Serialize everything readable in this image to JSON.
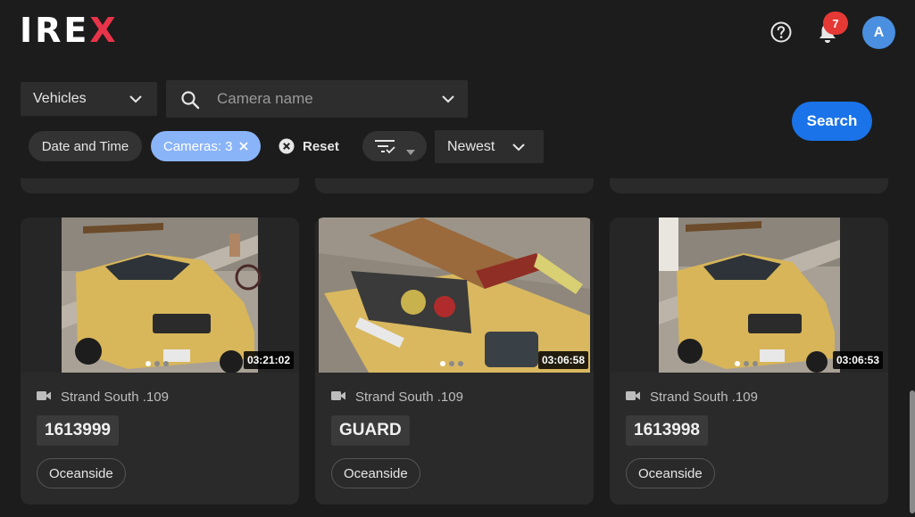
{
  "header": {
    "logo_main": "IRE",
    "logo_x": "X",
    "notification_count": "7",
    "avatar_initial": "A",
    "icons": [
      "help-circle-icon",
      "bell-icon"
    ]
  },
  "filters": {
    "type_value": "Vehicles",
    "camera_placeholder": "Camera name",
    "date_chip": "Date and Time",
    "cameras_chip": "Cameras: 3",
    "reset_label": "Reset",
    "sort_value": "Newest",
    "search_label": "Search"
  },
  "results": [
    {
      "timestamp": "03:21:02",
      "camera": "Strand South .109",
      "plate": "1613999",
      "location": "Oceanside",
      "dot_active": 0
    },
    {
      "timestamp": "03:06:58",
      "camera": "Strand South .109",
      "plate": "GUARD",
      "location": "Oceanside",
      "dot_active": 0
    },
    {
      "timestamp": "03:06:53",
      "camera": "Strand South .109",
      "plate": "1613998",
      "location": "Oceanside",
      "dot_active": 0
    }
  ],
  "colors": {
    "accent": "#1a73e8",
    "chip_active": "#8ab4f8",
    "badge": "#e53935",
    "logo_x": "#e8344a",
    "avatar": "#4a8fe0"
  }
}
